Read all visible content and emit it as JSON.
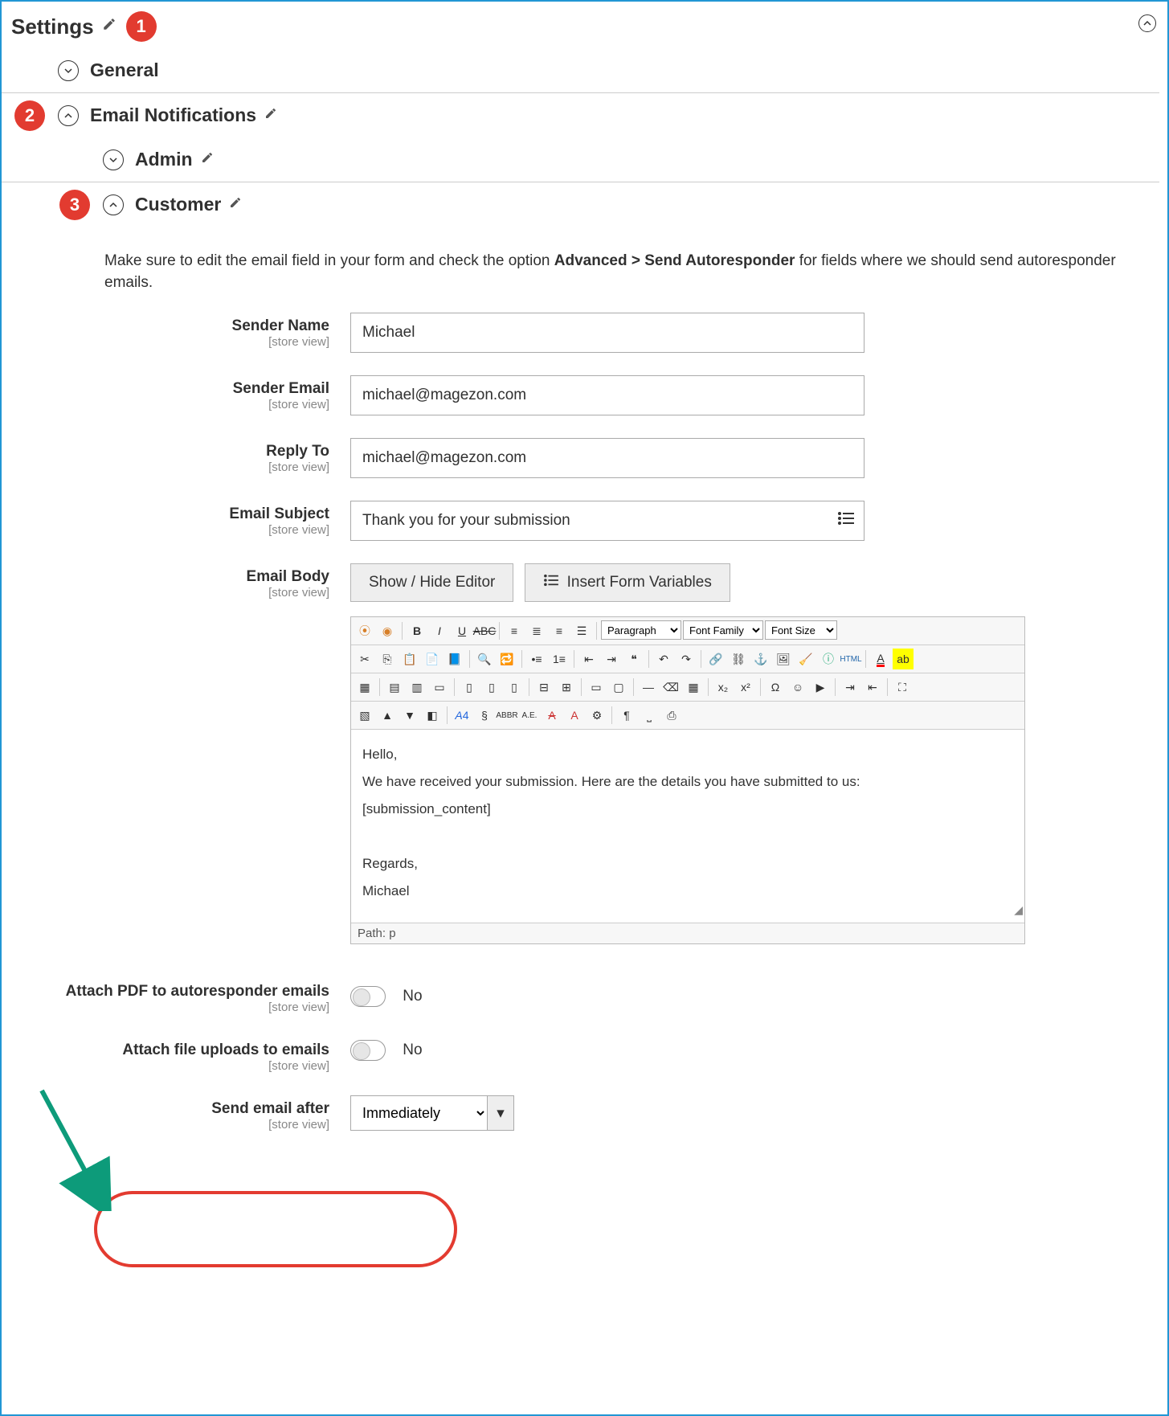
{
  "header": {
    "title": "Settings"
  },
  "badges": {
    "one": "1",
    "two": "2",
    "three": "3"
  },
  "sections": {
    "general": "General",
    "email_notifications": "Email Notifications",
    "admin": "Admin",
    "customer": "Customer"
  },
  "help": {
    "prefix": "Make sure to edit the email field in your form and check the option ",
    "bold": "Advanced > Send Autoresponder",
    "suffix": " for fields where we should send autoresponder emails."
  },
  "fields": {
    "scope": "[store view]",
    "sender_name": {
      "label": "Sender Name",
      "value": "Michael"
    },
    "sender_email": {
      "label": "Sender Email",
      "value": "michael@magezon.com"
    },
    "reply_to": {
      "label": "Reply To",
      "value": "michael@magezon.com"
    },
    "email_subject": {
      "label": "Email Subject",
      "value": "Thank you for your submission"
    },
    "email_body": {
      "label": "Email Body",
      "show_hide": "Show / Hide Editor",
      "insert_vars": "Insert Form Variables",
      "paragraph": "Paragraph",
      "font_family": "Font Family",
      "font_size": "Font Size",
      "html": "HTML",
      "content_line1": "Hello,",
      "content_line2": "We have received your submission. Here are the details you have submitted to us:",
      "content_line3": "[submission_content]",
      "content_line4": "Regards,",
      "content_line5": "Michael",
      "path_label": "Path: p"
    },
    "attach_pdf": {
      "label": "Attach PDF to autoresponder emails",
      "value": "No"
    },
    "attach_files": {
      "label": "Attach file uploads to emails",
      "value": "No"
    },
    "send_after": {
      "label": "Send email after",
      "value": "Immediately"
    }
  }
}
